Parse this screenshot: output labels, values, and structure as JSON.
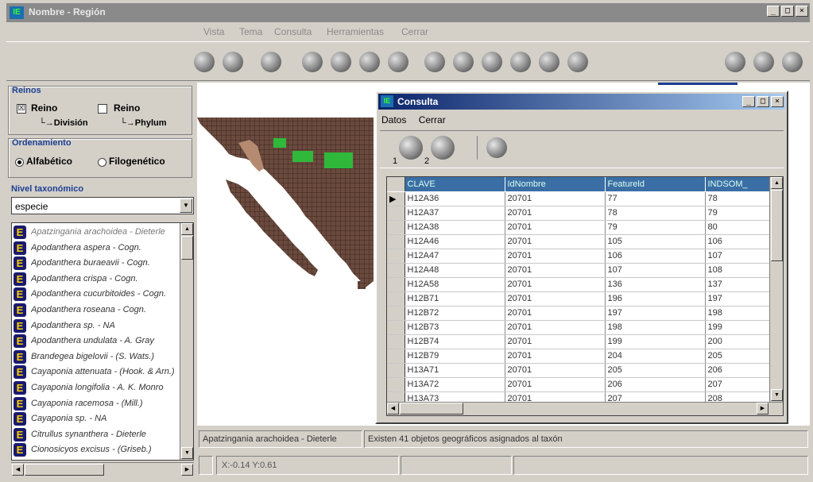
{
  "window": {
    "title": "Nombre - Región",
    "min": "_",
    "max": "□",
    "close": "×",
    "app_icon": "IE"
  },
  "menu": {
    "items": [
      "Vista",
      "Tema",
      "Consulta",
      "Herramientas",
      "Cerrar"
    ]
  },
  "toolbar": {
    "icons": [
      "globe-icon",
      "print-icon",
      "layer-icon",
      "zoom-in-icon",
      "zoom-out-icon",
      "pan-hand-icon",
      "rotate-icon",
      "pointer-icon",
      "grid-icon",
      "wrench-icon",
      "region-icon",
      "identify-icon",
      "query-icon"
    ],
    "right_icons": [
      "info-icon",
      "map-icon",
      "exit-icon"
    ]
  },
  "reinos": {
    "title": "Reinos",
    "reino1": {
      "label": "Reino",
      "sub": "└→División",
      "checked": "☒"
    },
    "reino2": {
      "label": "Reino",
      "sub": "└→Phylum",
      "checked": ""
    }
  },
  "ordenamiento": {
    "title": "Ordenamiento",
    "options": [
      "Alfabético",
      "Filogenético"
    ],
    "selected": "Alfabético"
  },
  "nivel": {
    "title": "Nivel taxonómico",
    "value": "especie"
  },
  "taxa": [
    "Apatzingania arachoidea - Dieterle",
    "Apodanthera aspera - Cogn.",
    "Apodanthera buraeavii - Cogn.",
    "Apodanthera crispa - Cogn.",
    "Apodanthera cucurbitoides - Cogn.",
    "Apodanthera roseana - Cogn.",
    "Apodanthera sp. - NA",
    "Apodanthera undulata - A. Gray",
    "Brandegea bigelovii - (S. Wats.)",
    "Cayaponia attenuata - (Hook. & Arn.)",
    "Cayaponia longifolia - A. K. Monro",
    "Cayaponia racemosa - (Mill.)",
    "Cayaponia sp. - NA",
    "Citrullus synanthera - Dieterle",
    "Cionosicyos excisus - (Griseb.)"
  ],
  "status": {
    "taxon": "Apatzingania arachoidea - Dieterle",
    "message": "Existen 41 objetos geográficos asignados al taxón"
  },
  "coords": {
    "text": "X:-0.14 Y:0.61"
  },
  "consulta": {
    "title": "Consulta",
    "menu": [
      "Datos",
      "Cerrar"
    ],
    "tb_numbers": [
      "1",
      "2"
    ],
    "columns": [
      "CLAVE",
      "IdNombre",
      "Featureld",
      "INDSOM_"
    ],
    "rows": [
      [
        "H12A36",
        "20701",
        "77",
        "78"
      ],
      [
        "H12A37",
        "20701",
        "78",
        "79"
      ],
      [
        "H12A38",
        "20701",
        "79",
        "80"
      ],
      [
        "H12A46",
        "20701",
        "105",
        "106"
      ],
      [
        "H12A47",
        "20701",
        "106",
        "107"
      ],
      [
        "H12A48",
        "20701",
        "107",
        "108"
      ],
      [
        "H12A58",
        "20701",
        "136",
        "137"
      ],
      [
        "H12B71",
        "20701",
        "196",
        "197"
      ],
      [
        "H12B72",
        "20701",
        "197",
        "198"
      ],
      [
        "H12B73",
        "20701",
        "198",
        "199"
      ],
      [
        "H12B74",
        "20701",
        "199",
        "200"
      ],
      [
        "H12B79",
        "20701",
        "204",
        "205"
      ],
      [
        "H13A71",
        "20701",
        "205",
        "206"
      ],
      [
        "H13A72",
        "20701",
        "206",
        "207"
      ],
      [
        "H13A73",
        "20701",
        "207",
        "208"
      ]
    ],
    "current_row_marker": "▶"
  },
  "colors": {
    "map_land": "#6b4a3e",
    "map_grid": "#3b2620",
    "map_highlight": "#2fb83a",
    "map_tan": "#b48a70"
  }
}
